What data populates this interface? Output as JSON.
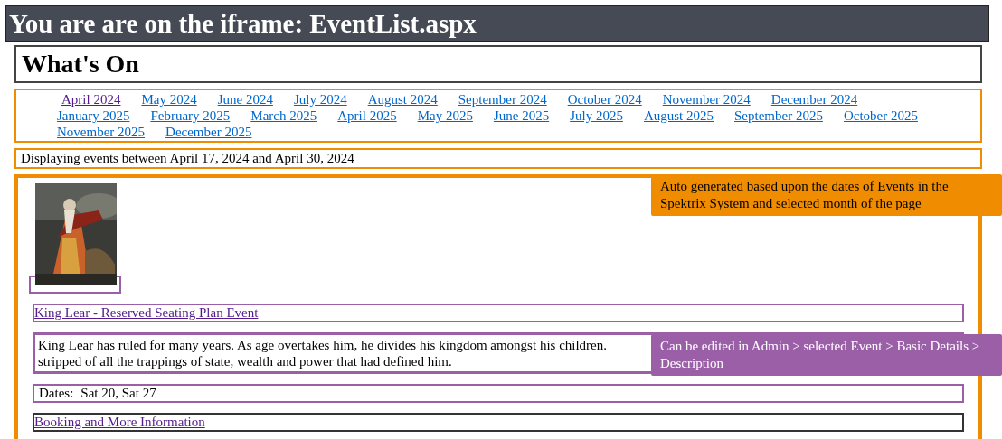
{
  "iframe_banner": {
    "title": "You are are on the iframe: EventList.aspx"
  },
  "page_title": "What's On",
  "months": [
    {
      "label": "April 2024",
      "selected": true
    },
    {
      "label": "May 2024",
      "selected": false
    },
    {
      "label": "June 2024",
      "selected": false
    },
    {
      "label": "July 2024",
      "selected": false
    },
    {
      "label": "August 2024",
      "selected": false
    },
    {
      "label": "September 2024",
      "selected": false
    },
    {
      "label": "October 2024",
      "selected": false
    },
    {
      "label": "November 2024",
      "selected": false
    },
    {
      "label": "December 2024",
      "selected": false
    },
    {
      "label": "January 2025",
      "selected": false
    },
    {
      "label": "February 2025",
      "selected": false
    },
    {
      "label": "March 2025",
      "selected": false
    },
    {
      "label": "April 2025",
      "selected": false
    },
    {
      "label": "May 2025",
      "selected": false
    },
    {
      "label": "June 2025",
      "selected": false
    },
    {
      "label": "July 2025",
      "selected": false
    },
    {
      "label": "August 2025",
      "selected": false
    },
    {
      "label": "September 2025",
      "selected": false
    },
    {
      "label": "October 2025",
      "selected": false
    },
    {
      "label": "November 2025",
      "selected": false
    },
    {
      "label": "December 2025",
      "selected": false
    }
  ],
  "date_range": "Displaying events between April 17, 2024 and April 30, 2024",
  "event": {
    "title": "King Lear - Reserved Seating Plan Event",
    "description_lines": [
      "King Lear has ruled for many years. As age overtakes him, he divides his kingdom amongst his children.",
      "stripped of all the trappings of state, wealth and power that had defined him."
    ],
    "dates_label": "Dates:",
    "dates": "Sat 20, Sat 27",
    "booking_link": "Booking and More Information"
  },
  "annotations": [
    {
      "text": "Auto generated based upon the dates of Events in the Spektrix System and selected month of the page",
      "color": "#f08c00"
    },
    {
      "text": "Can be edited in Admin > selected Event > Basic Details > Description",
      "color": "#9b5fa8"
    }
  ]
}
